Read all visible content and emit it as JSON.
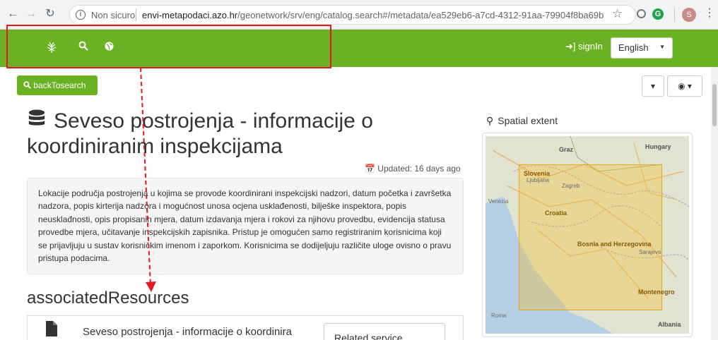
{
  "browser": {
    "security_label": "Non sicuro",
    "url_domain": "envi-metapodaci.azo.hr",
    "url_path": "/geonetwork/srv/eng/catalog.search#/metadata/ea529eb6-a7cd-4312-91aa-79904f8ba69b",
    "profile_initial": "S"
  },
  "navbar": {
    "signin_label": "signIn",
    "language": "English"
  },
  "toolbar": {
    "back_label": "backTosearch"
  },
  "record": {
    "title": "Seveso postrojenja - informacije o koordiniranim inspekcijama",
    "updated": "Updated: 16 days ago",
    "abstract": "Lokacije područja postrojenja u kojima se provode koordinirani inspekcijski nadzori, datum početka i završetka nadzora, popis kirterija nadzora i mogućnost unosa ocjena usklađenosti, bilješke inspektora, popis neusklađnosti, opis propisanih mjera, datum izdavanja mjera i rokovi za njihovu provedbu, evidencija statusa provedbe mjera, učitavanje inspekcijskih zapisnika. Pristup je omogućen samo registriranim korisnicima koji se prijavljuju u sustav korisničkim imenom i zaporkom. Korisnicima se dodijeljuju različite uloge ovisno o pravu pristupa podacima."
  },
  "associated": {
    "heading": "associatedResources",
    "resource_title": "Seveso postrojenja - informacije o koordinira",
    "resource_type": "Related service"
  },
  "spatial": {
    "label": "Spatial extent",
    "map_labels": [
      "Graz",
      "Hungary",
      "Slovenia",
      "Ljubljana",
      "Zagreb",
      "Venezia",
      "Croatia",
      "Bosnia and Herzegovina",
      "Sarajevo",
      "Montenegro",
      "Roma",
      "Albania"
    ]
  }
}
